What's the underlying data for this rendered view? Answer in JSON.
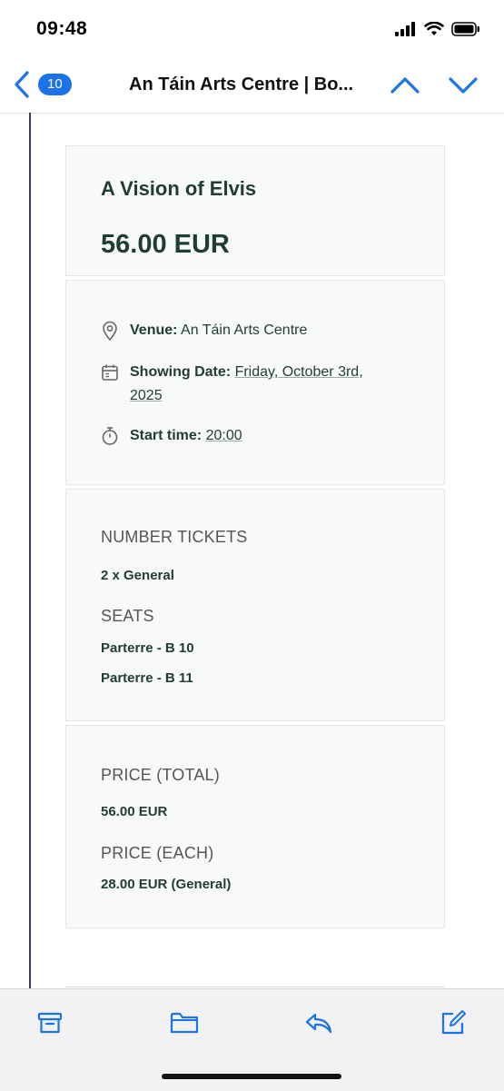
{
  "status_bar": {
    "time": "09:48"
  },
  "nav": {
    "unread_count": "10",
    "title": "An Táin Arts Centre | Bo..."
  },
  "event": {
    "name": "A Vision of Elvis",
    "price": "56.00 EUR"
  },
  "details": {
    "venue_label": "Venue:",
    "venue_value": "An Táin Arts Centre",
    "date_label": "Showing Date:",
    "date_value": "Friday, October 3rd, 2025",
    "time_label": "Start time:",
    "time_value": "20:00"
  },
  "tickets": {
    "heading": "NUMBER TICKETS",
    "count": "2 x General",
    "seats_heading": "SEATS",
    "seats": [
      "Parterre - B 10",
      "Parterre - B 11"
    ]
  },
  "pricing": {
    "total_heading": "PRICE (TOTAL)",
    "total_value": "56.00 EUR",
    "each_heading": "PRICE (EACH)",
    "each_value": "28.00 EUR (General)"
  },
  "icons": {
    "back": "chevron-left-icon",
    "prev": "chevron-up-icon",
    "next": "chevron-down-icon",
    "archive": "archive-icon",
    "move": "folder-icon",
    "reply": "reply-icon",
    "compose": "compose-icon"
  },
  "colors": {
    "accent": "#1a73e8",
    "text_dark": "#1f3d33"
  }
}
